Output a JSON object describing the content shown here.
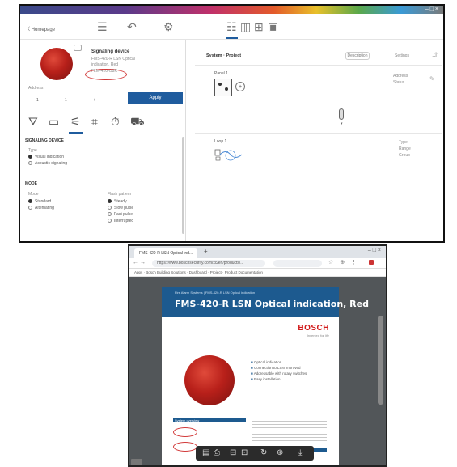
{
  "app": {
    "window_controls": "– □ ×",
    "toolbar": {
      "back_label": "〈 Homepage",
      "icons": [
        "menu-icon",
        "undo-icon",
        "settings-icon",
        "text-view-icon",
        "columns-view-icon",
        "grid-view-icon",
        "image-view-icon"
      ]
    },
    "device": {
      "name": "Signaling device",
      "description_lines": [
        "FMS-420-R LSN Optical",
        "indication, Red",
        "FLM-420-O8R"
      ],
      "address_label": "Address",
      "address_values": [
        "1",
        "-",
        "1",
        "−",
        "+"
      ],
      "apply_label": "Apply",
      "tabs": [
        "network-icon",
        "panel-icon",
        "signal-icon",
        "frame-icon",
        "timer-icon",
        "truck-icon"
      ]
    },
    "signaling_section": {
      "title": "SIGNALING DEVICE",
      "group_label": "Type",
      "options": [
        {
          "label": "Visual indication",
          "selected": true
        },
        {
          "label": "Acoustic signaling",
          "selected": false
        }
      ]
    },
    "mode_section": {
      "title": "MODE",
      "left_label": "Mode",
      "left_options": [
        {
          "label": "Standard",
          "selected": true
        },
        {
          "label": "Alternating",
          "selected": false
        }
      ],
      "right_label": "Flash pattern",
      "right_options": [
        {
          "label": "Steady",
          "selected": true
        },
        {
          "label": "Slow pulse",
          "selected": false
        },
        {
          "label": "Fast pulse",
          "selected": false
        },
        {
          "label": "Interrupted",
          "selected": false
        }
      ]
    },
    "system": {
      "title": "System · Project",
      "pill_left": "Description",
      "pill_right": "Settings",
      "loop1": {
        "label": "Panel 1",
        "meta": [
          "Address",
          "Status"
        ]
      },
      "loop2": {
        "label": "Loop 1",
        "meta": [
          "Type",
          "Range",
          "Group"
        ]
      }
    }
  },
  "browser": {
    "tab_title": "FMS-420-R LSN Optical ind...",
    "url": "https://www.boschsecurity.com/xc/en/products/...",
    "bookmarks": "Apps  ·  Bosch Building Solutions  ·  Dashboard  ·  Project  ·  Product Documentation",
    "pdf": {
      "subtitle": "Fire Alarm Systems | FMS-420-R LSN Optical indication",
      "title": "FMS-420-R LSN Optical indication, Red",
      "bosch": "BOSCH",
      "bosch_tagline": "Invented for life",
      "bullets": [
        "Optical indication",
        "Connection to LSN improved",
        "Addressable with rotary switches",
        "Easy installation"
      ],
      "section_label": "System overview"
    },
    "toolbar_icons": [
      "save-icon",
      "print-icon",
      "zoom-out-icon",
      "fit-icon",
      "rotate-icon",
      "zoom-in-icon",
      "download-icon"
    ]
  }
}
